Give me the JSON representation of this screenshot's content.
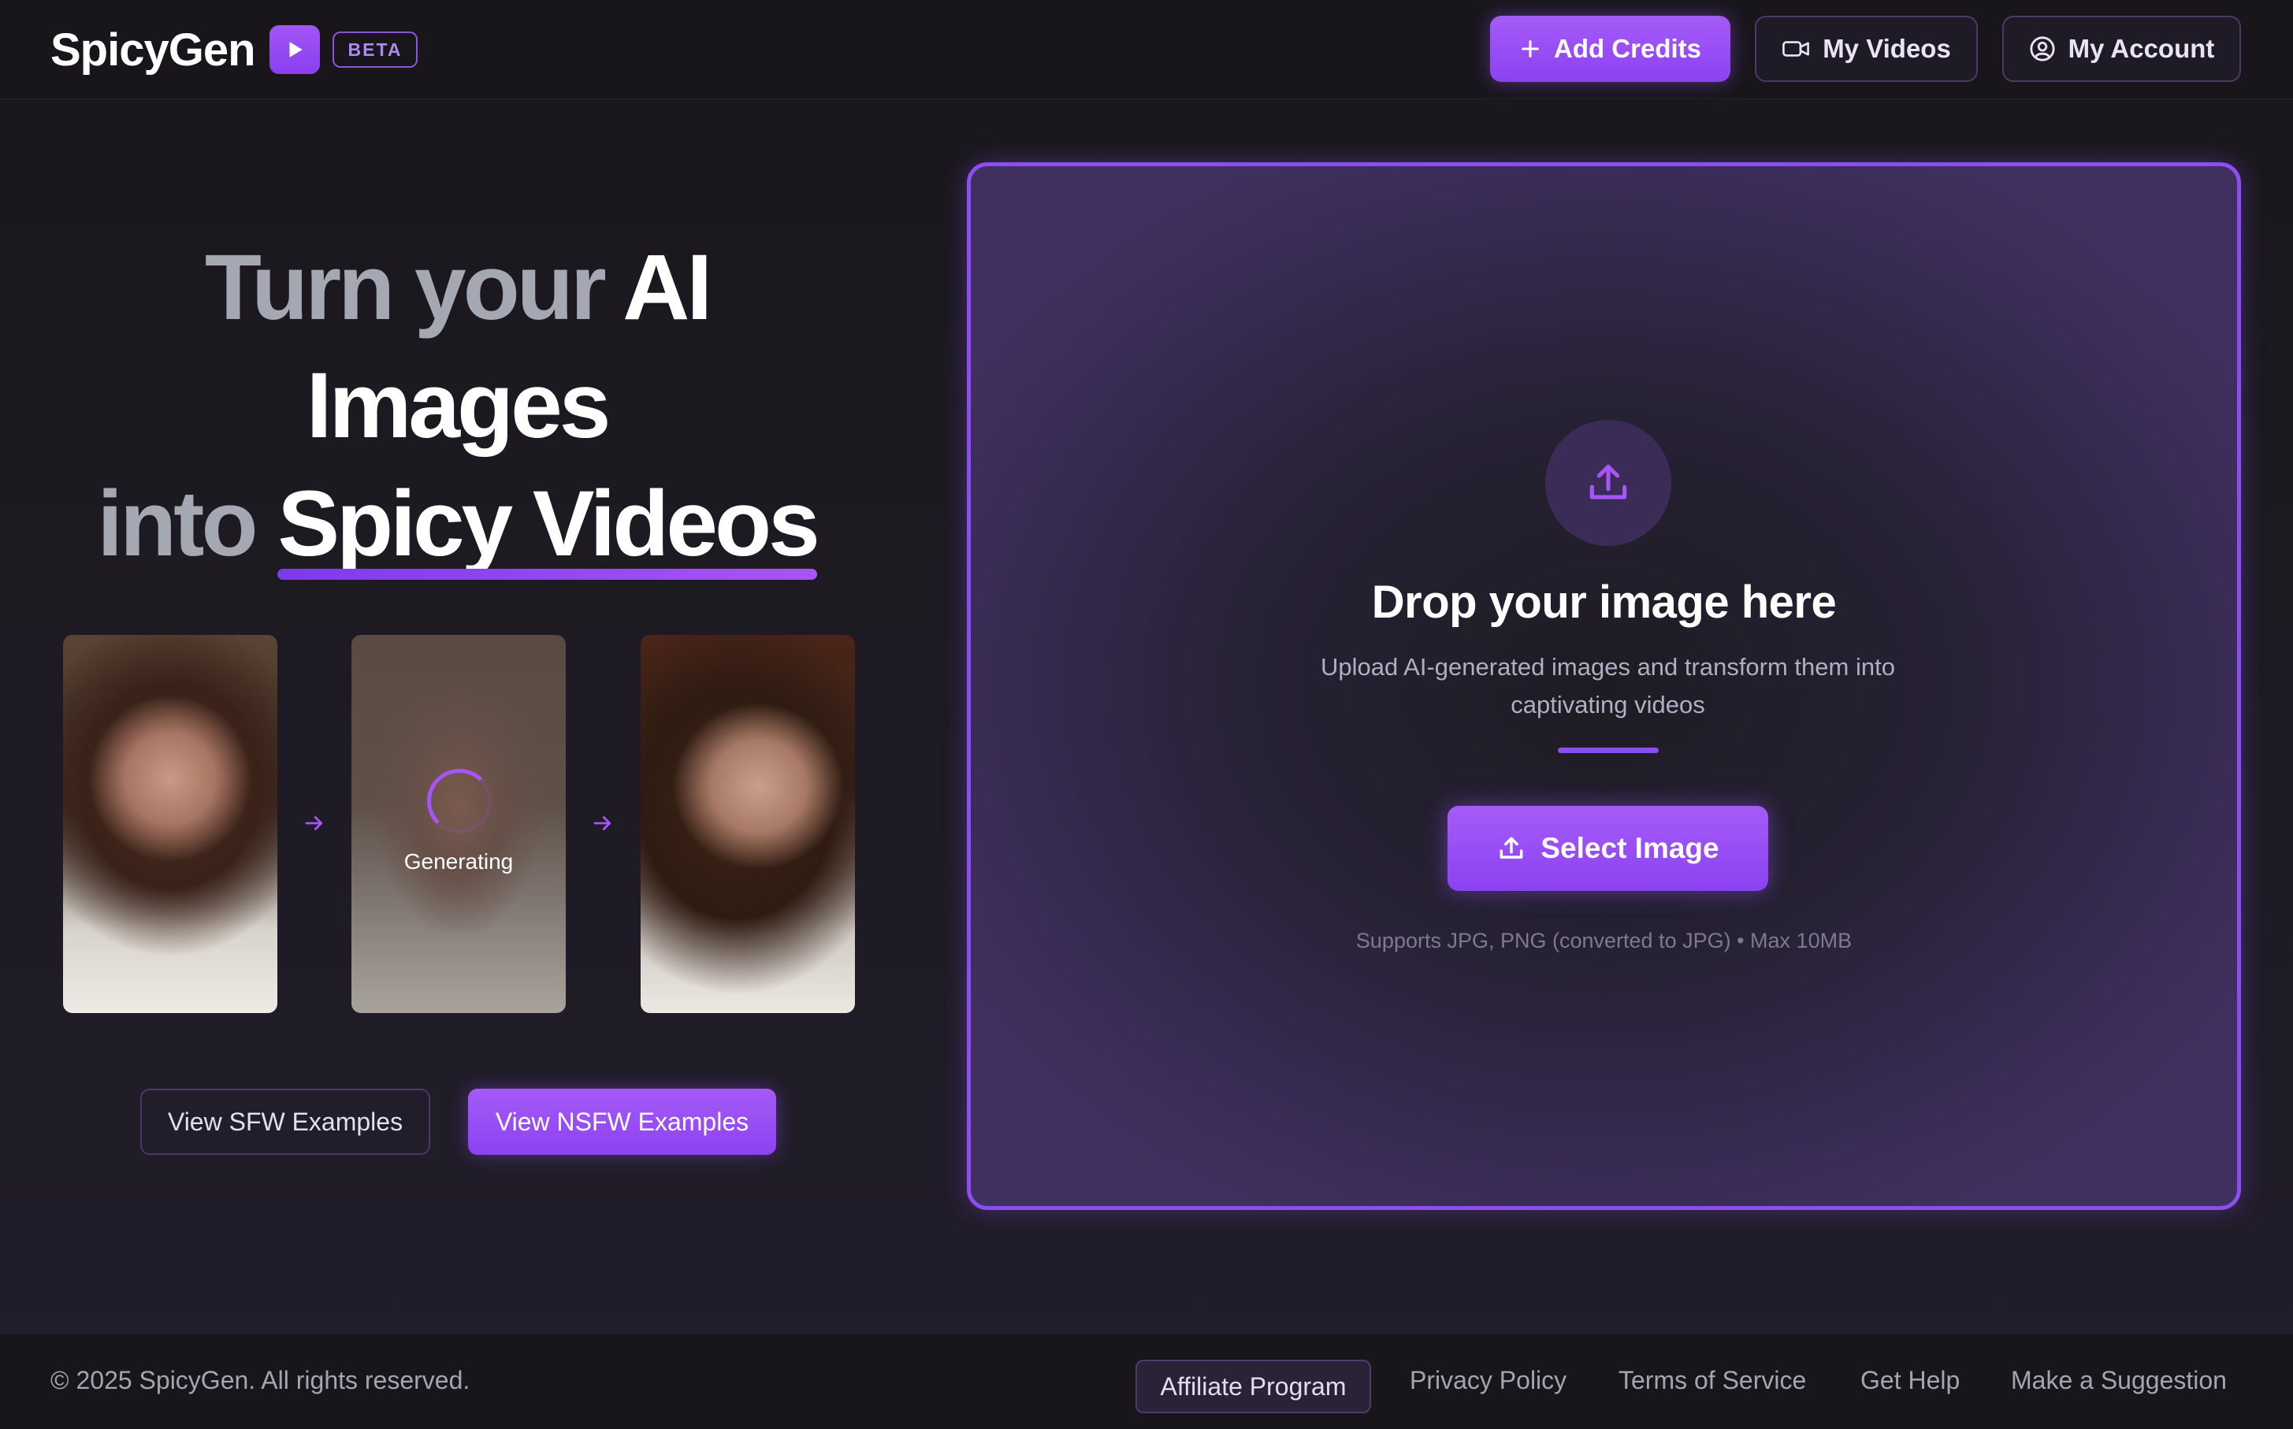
{
  "header": {
    "brand_name": "SpicyGen",
    "beta_badge": "BETA",
    "add_credits_label": "Add Credits",
    "my_videos_label": "My Videos",
    "my_account_label": "My Account"
  },
  "hero": {
    "line1_muted": "Turn your ",
    "line1_bright": "AI",
    "line2_bright": "Images",
    "line3_muted": "into ",
    "line3_highlight": "Spicy Videos",
    "generating_label": "Generating",
    "sfw_button": "View SFW Examples",
    "nsfw_button": "View NSFW Examples"
  },
  "upload": {
    "title": "Drop your image here",
    "description": "Upload AI-generated images and transform them into captivating videos",
    "select_button": "Select Image",
    "hint": "Supports JPG, PNG (converted to JPG) • Max 10MB"
  },
  "footer": {
    "copyright": "© 2025 SpicyGen. All rights reserved.",
    "links": [
      "Affiliate Program",
      "Privacy Policy",
      "Terms of Service",
      "Get Help",
      "Make a Suggestion"
    ]
  },
  "colors": {
    "accent": "#9b4ff5",
    "background": "#1b1820",
    "muted_text": "#a5a7b3"
  },
  "icons": {
    "brand": "play-icon",
    "add_credits": "plus-icon",
    "my_videos": "video-camera-icon",
    "my_account": "user-circle-icon",
    "upload": "upload-icon",
    "flow_arrow": "arrow-right-icon"
  }
}
